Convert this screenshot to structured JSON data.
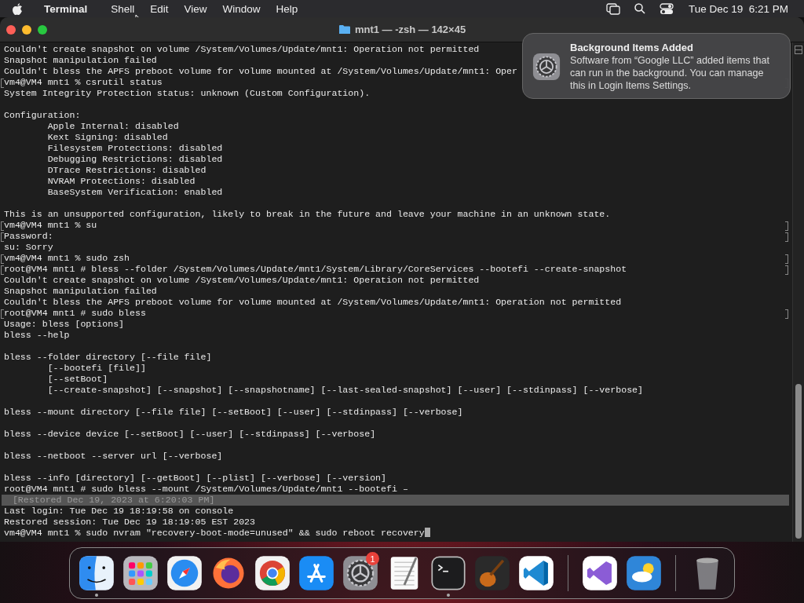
{
  "menu_bar": {
    "app": "Terminal",
    "menus": [
      "Shell",
      "Edit",
      "View",
      "Window",
      "Help"
    ],
    "clock": "Tue Dec 19  6:21 PM"
  },
  "window": {
    "title": "mnt1 — -zsh — 142×45"
  },
  "terminal": {
    "lines": [
      {
        "kind": "text",
        "text": "Couldn't create snapshot on volume /System/Volumes/Update/mnt1: Operation not permitted",
        "marked": false
      },
      {
        "kind": "text",
        "text": "Snapshot manipulation failed",
        "marked": false
      },
      {
        "kind": "text",
        "text": "Couldn't bless the APFS preboot volume for volume mounted at /System/Volumes/Update/mnt1: Oper",
        "marked": false
      },
      {
        "kind": "text",
        "text": "vm4@VM4 mnt1 % csrutil status",
        "marked": true
      },
      {
        "kind": "text",
        "text": "System Integrity Protection status: unknown (Custom Configuration).",
        "marked": false
      },
      {
        "kind": "blank"
      },
      {
        "kind": "text",
        "text": "Configuration:",
        "marked": false
      },
      {
        "kind": "text",
        "text": "        Apple Internal: disabled",
        "marked": false
      },
      {
        "kind": "text",
        "text": "        Kext Signing: disabled",
        "marked": false
      },
      {
        "kind": "text",
        "text": "        Filesystem Protections: disabled",
        "marked": false
      },
      {
        "kind": "text",
        "text": "        Debugging Restrictions: disabled",
        "marked": false
      },
      {
        "kind": "text",
        "text": "        DTrace Restrictions: disabled",
        "marked": false
      },
      {
        "kind": "text",
        "text": "        NVRAM Protections: disabled",
        "marked": false
      },
      {
        "kind": "text",
        "text": "        BaseSystem Verification: enabled",
        "marked": false
      },
      {
        "kind": "blank"
      },
      {
        "kind": "text",
        "text": "This is an unsupported configuration, likely to break in the future and leave your machine in an unknown state.",
        "marked": false
      },
      {
        "kind": "text",
        "text": "vm4@VM4 mnt1 % su",
        "marked": true
      },
      {
        "kind": "text",
        "text": "Password:",
        "marked": true
      },
      {
        "kind": "text",
        "text": "su: Sorry",
        "marked": false
      },
      {
        "kind": "text",
        "text": "vm4@VM4 mnt1 % sudo zsh",
        "marked": true
      },
      {
        "kind": "text",
        "text": "root@VM4 mnt1 # bless --folder /System/Volumes/Update/mnt1/System/Library/CoreServices --bootefi --create-snapshot",
        "marked": true
      },
      {
        "kind": "text",
        "text": "Couldn't create snapshot on volume /System/Volumes/Update/mnt1: Operation not permitted",
        "marked": false
      },
      {
        "kind": "text",
        "text": "Snapshot manipulation failed",
        "marked": false
      },
      {
        "kind": "text",
        "text": "Couldn't bless the APFS preboot volume for volume mounted at /System/Volumes/Update/mnt1: Operation not permitted",
        "marked": false
      },
      {
        "kind": "text",
        "text": "root@VM4 mnt1 # sudo bless",
        "marked": true
      },
      {
        "kind": "text",
        "text": "Usage: bless [options]",
        "marked": false
      },
      {
        "kind": "text",
        "text": "bless --help",
        "marked": false
      },
      {
        "kind": "blank"
      },
      {
        "kind": "text",
        "text": "bless --folder directory [--file file]",
        "marked": false
      },
      {
        "kind": "text",
        "text": "        [--bootefi [file]]",
        "marked": false
      },
      {
        "kind": "text",
        "text": "        [--setBoot]",
        "marked": false
      },
      {
        "kind": "text",
        "text": "        [--create-snapshot] [--snapshot] [--snapshotname] [--last-sealed-snapshot] [--user] [--stdinpass] [--verbose]",
        "marked": false
      },
      {
        "kind": "blank"
      },
      {
        "kind": "text",
        "text": "bless --mount directory [--file file] [--setBoot] [--user] [--stdinpass] [--verbose]",
        "marked": false
      },
      {
        "kind": "blank"
      },
      {
        "kind": "text",
        "text": "bless --device device [--setBoot] [--user] [--stdinpass] [--verbose]",
        "marked": false
      },
      {
        "kind": "blank"
      },
      {
        "kind": "text",
        "text": "bless --netboot --server url [--verbose]",
        "marked": false
      },
      {
        "kind": "blank"
      },
      {
        "kind": "text",
        "text": "bless --info [directory] [--getBoot] [--plist] [--verbose] [--version]",
        "marked": false
      },
      {
        "kind": "text",
        "text": "root@VM4 mnt1 # sudo bless --mount /System/Volumes/Update/mnt1 --bootefi –",
        "marked": false
      },
      {
        "kind": "restored",
        "text": "  [Restored Dec 19, 2023 at 6:20:03 PM]"
      },
      {
        "kind": "text",
        "text": "Last login: Tue Dec 19 18:19:58 on console",
        "marked": false
      },
      {
        "kind": "text",
        "text": "Restored session: Tue Dec 19 18:19:05 EST 2023",
        "marked": false
      },
      {
        "kind": "prompt",
        "text": "vm4@VM4 mnt1 % sudo nvram \"recovery-boot-mode=unused\" && sudo reboot recovery"
      }
    ]
  },
  "notification": {
    "title": "Background Items Added",
    "body": "Software from “Google LLC” added items that can run in the background. You can manage this in Login Items Settings."
  },
  "dock": {
    "items": [
      {
        "kind": "finder",
        "running": true
      },
      {
        "kind": "launchpad",
        "running": false
      },
      {
        "kind": "safari",
        "running": false
      },
      {
        "kind": "firefox",
        "running": false
      },
      {
        "kind": "chrome",
        "running": false
      },
      {
        "kind": "appstore",
        "running": false
      },
      {
        "kind": "settings",
        "running": false,
        "badge": "1"
      },
      {
        "kind": "textedit",
        "running": false
      },
      {
        "kind": "terminal",
        "running": true
      },
      {
        "kind": "garageband",
        "running": false
      },
      {
        "kind": "vscode",
        "running": false
      },
      {
        "kind": "divider"
      },
      {
        "kind": "visualstudio",
        "running": false
      },
      {
        "kind": "weather",
        "running": false
      },
      {
        "kind": "divider"
      },
      {
        "kind": "trash",
        "running": false
      }
    ]
  }
}
